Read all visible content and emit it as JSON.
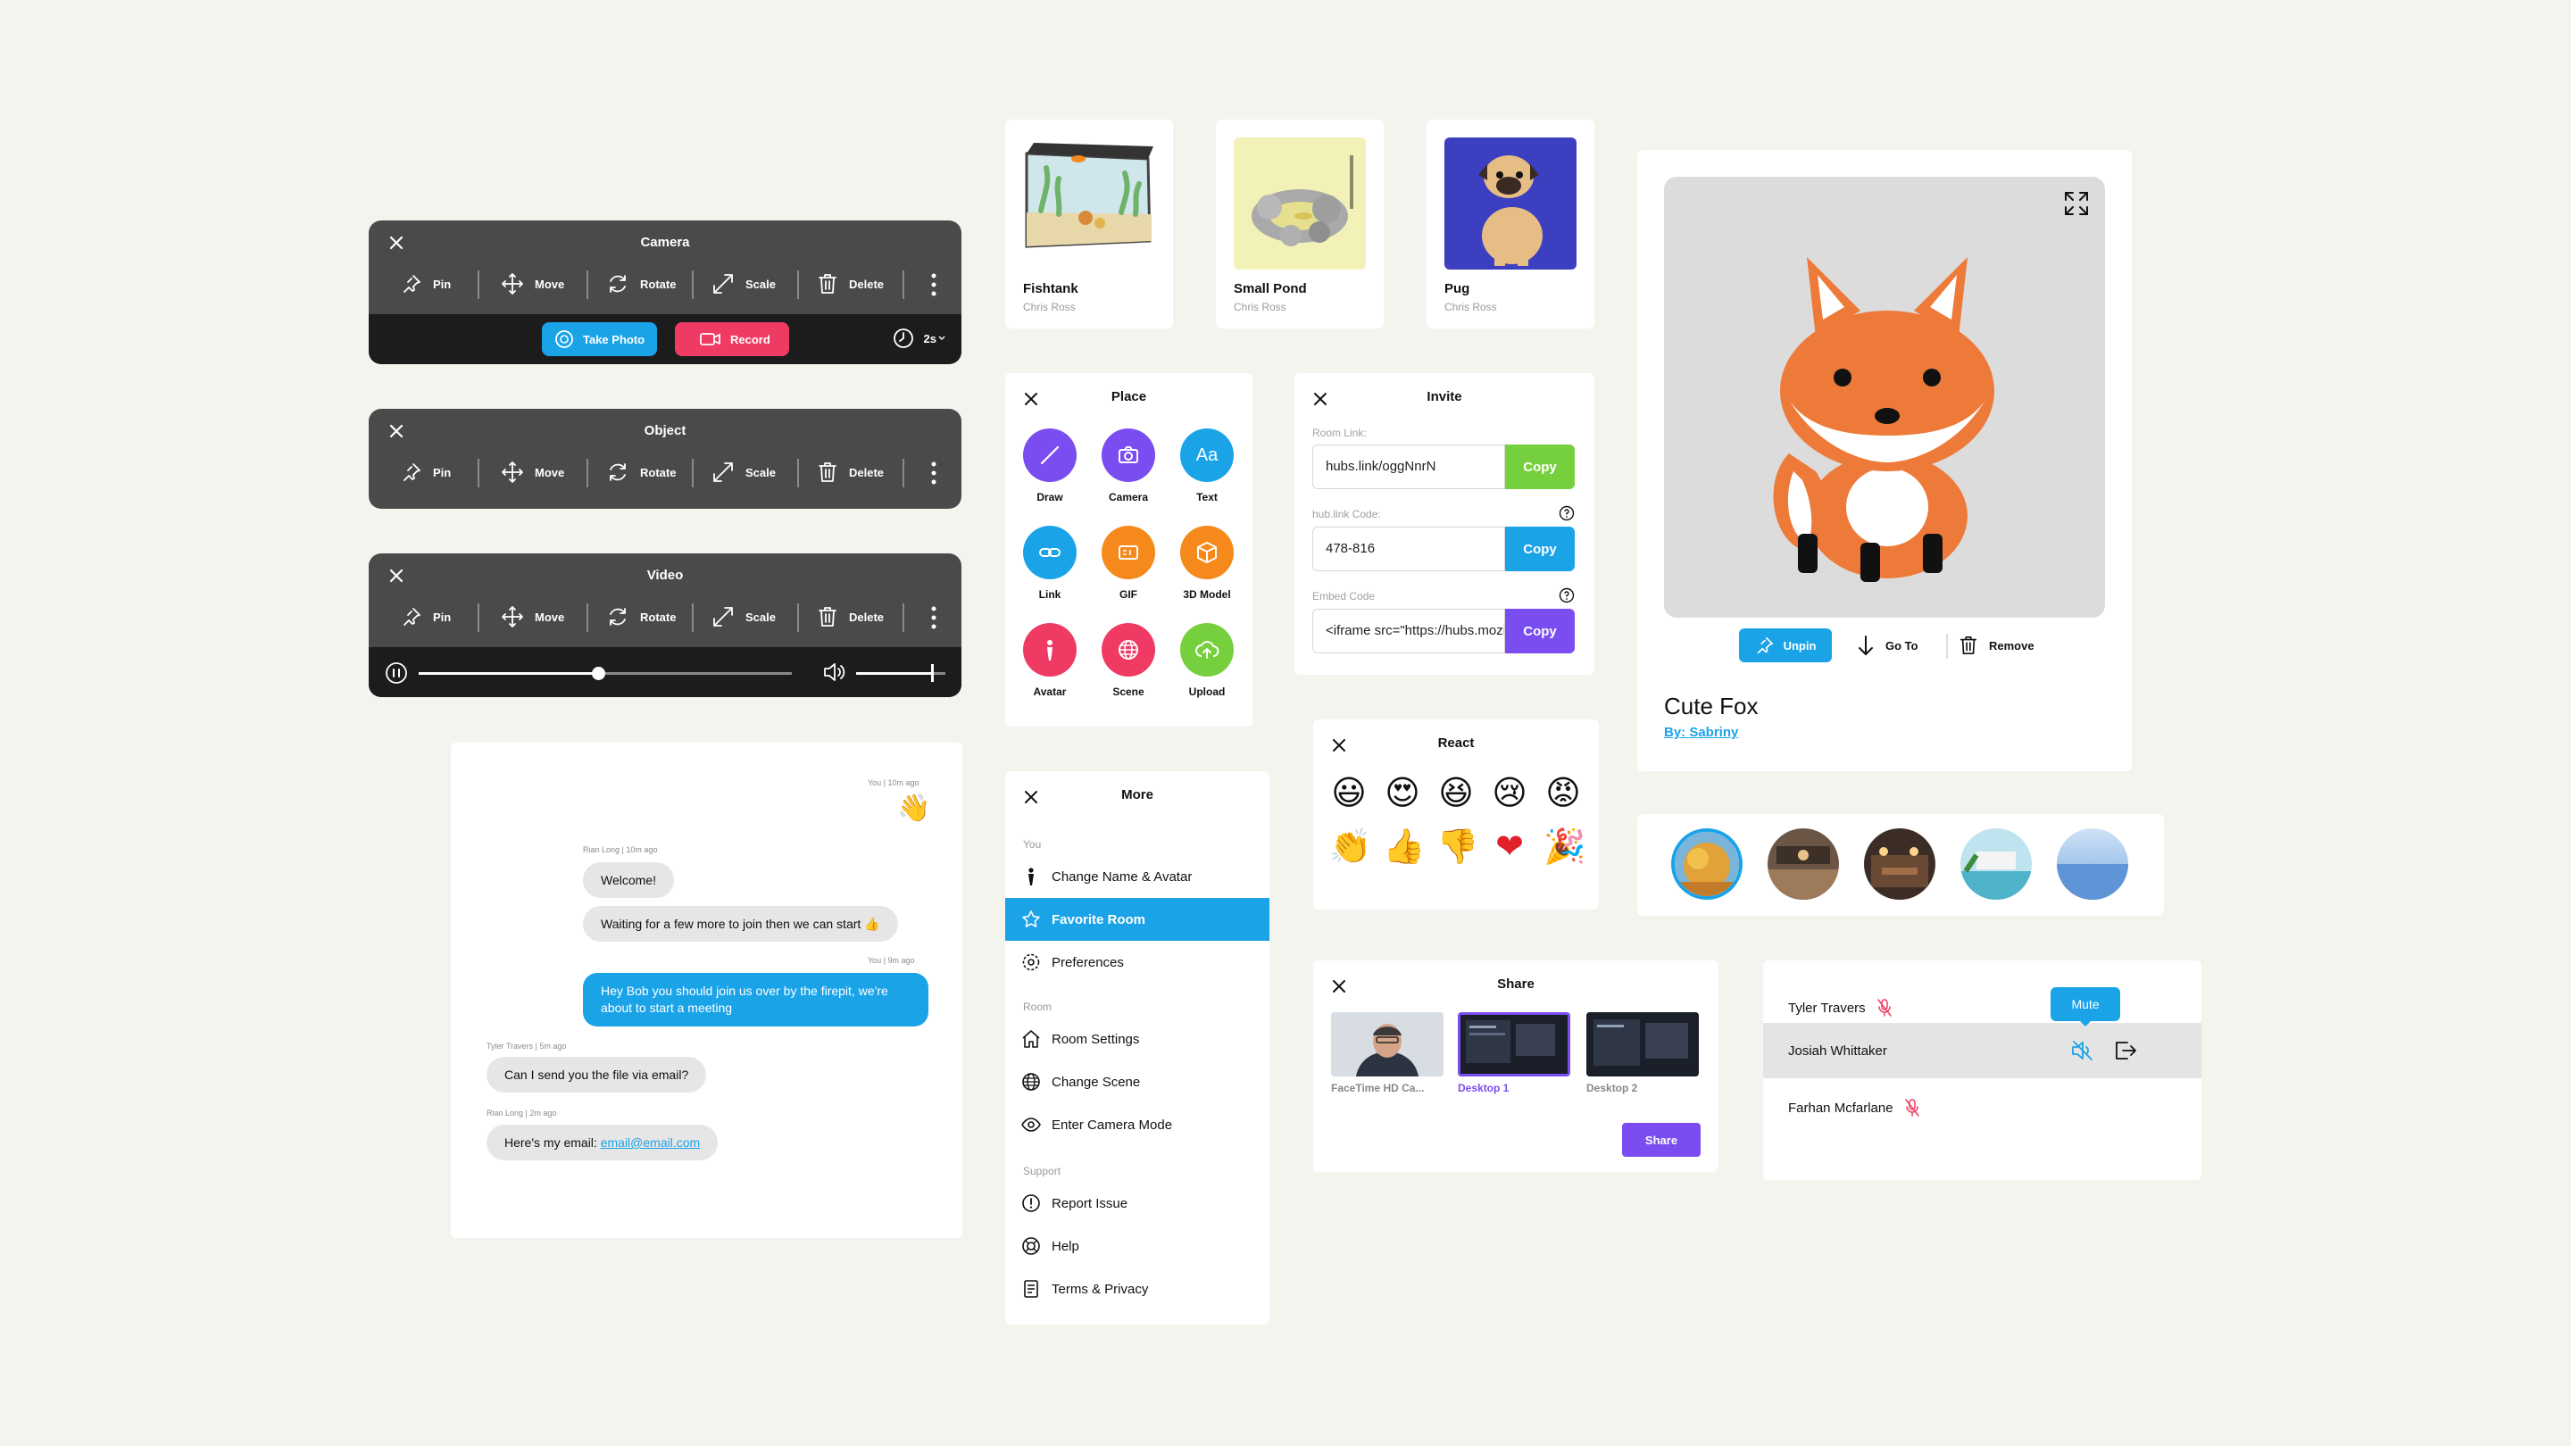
{
  "toolbars": {
    "camera": {
      "title": "Camera"
    },
    "object": {
      "title": "Object"
    },
    "video": {
      "title": "Video",
      "progress": 0.48,
      "volume": 0.85
    },
    "tools": [
      "Pin",
      "Move",
      "Rotate",
      "Scale",
      "Delete"
    ],
    "take_photo": "Take Photo",
    "record": "Record",
    "timer": "2s"
  },
  "thumbnails": [
    {
      "title": "Fishtank",
      "author": "Chris Ross"
    },
    {
      "title": "Small Pond",
      "author": "Chris Ross"
    },
    {
      "title": "Pug",
      "author": "Chris Ross"
    }
  ],
  "place": {
    "title": "Place",
    "items": [
      {
        "label": "Draw",
        "color": "#7a4df0"
      },
      {
        "label": "Camera",
        "color": "#7a4df0"
      },
      {
        "label": "Text",
        "color": "#1ba3e8"
      },
      {
        "label": "Link",
        "color": "#1ba3e8"
      },
      {
        "label": "GIF",
        "color": "#f5891c"
      },
      {
        "label": "3D Model",
        "color": "#f5891c"
      },
      {
        "label": "Avatar",
        "color": "#ef3b63"
      },
      {
        "label": "Scene",
        "color": "#ef3b63"
      },
      {
        "label": "Upload",
        "color": "#76cf3c"
      }
    ]
  },
  "invite": {
    "title": "Invite",
    "room_link_label": "Room Link:",
    "room_link": "hubs.link/oggNnrN",
    "code_label": "hub.link Code:",
    "code": "478-816",
    "embed_label": "Embed Code",
    "embed": "<iframe src=\"https://hubs.mozilla.com/",
    "copy": "Copy"
  },
  "react": {
    "title": "React",
    "emojis": [
      "😃",
      "😍",
      "😆",
      "😢",
      "😡",
      "👏",
      "👍",
      "👎",
      "❤",
      "🎉"
    ]
  },
  "share": {
    "title": "Share",
    "sources": [
      "FaceTime HD Ca...",
      "Desktop 1",
      "Desktop 2"
    ],
    "button": "Share"
  },
  "more": {
    "title": "More",
    "sections": {
      "you": "You",
      "room": "Room",
      "support": "Support"
    },
    "items": {
      "change_name": "Change Name & Avatar",
      "favorite": "Favorite Room",
      "preferences": "Preferences",
      "room_settings": "Room Settings",
      "change_scene": "Change Scene",
      "camera_mode": "Enter Camera Mode",
      "report": "Report Issue",
      "help": "Help",
      "terms": "Terms & Privacy"
    }
  },
  "chat": {
    "meta1": "You  |  10m ago",
    "wave": "👋",
    "meta2": "Rian Long  |  10m ago",
    "msg_welcome": "Welcome!",
    "msg_waiting": "Waiting for a few more to join then we can start 👍",
    "meta3": "You  |  9m ago",
    "msg_hey_1": "Hey Bob you should join us over by the firepit, we're",
    "msg_hey_2": "about to start a meeting",
    "meta4": "Tyler Travers  |  5m ago",
    "msg_file": "Can I send you the file via email?",
    "meta5": "Rian Long  |  2m ago",
    "msg_email_prefix": "Here's my email: ",
    "msg_email": "email@email.com"
  },
  "object_card": {
    "title": "Cute Fox",
    "author": "By: Sabriny",
    "unpin": "Unpin",
    "goto": "Go To",
    "remove": "Remove"
  },
  "people": {
    "rows": [
      "Tyler Travers",
      "Josiah Whittaker",
      "Farhan Mcfarlane"
    ],
    "tooltip": "Mute"
  },
  "colors": {
    "blue": "#1ba3e8",
    "purple": "#7a4df0",
    "green": "#76cf3c",
    "red": "#ef3b63",
    "dark": "#4a4a4a"
  }
}
